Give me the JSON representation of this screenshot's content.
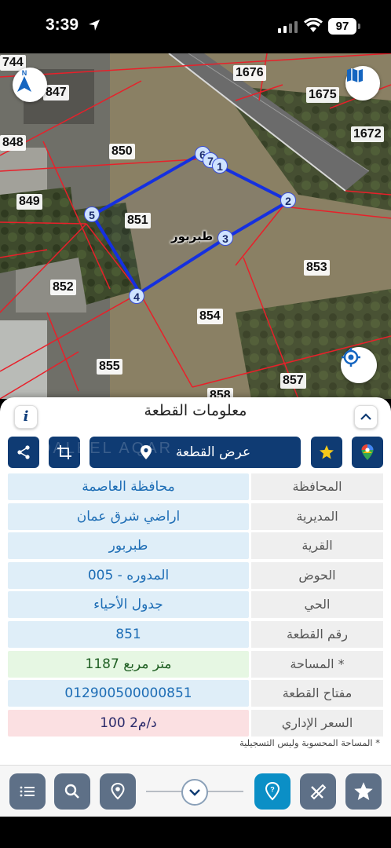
{
  "status_bar": {
    "time": "3:39",
    "battery": "97"
  },
  "map": {
    "parcels": [
      "744",
      "847",
      "1676",
      "1675",
      "1672",
      "848",
      "850",
      "849",
      "851",
      "852",
      "853",
      "854",
      "855",
      "857",
      "858"
    ],
    "vertices": [
      "6",
      "7",
      "1",
      "2",
      "3",
      "4",
      "5"
    ],
    "village_label": "طبربور"
  },
  "panel": {
    "title": "معلومات القطعة",
    "info_label": "i",
    "show_parcel_label": "عرض القطعة",
    "watermark": "DALEEL AQAR",
    "rows": [
      {
        "label": "المحافظة",
        "value": "محافظة العاصمة"
      },
      {
        "label": "المديرية",
        "value": "اراضي شرق عمان"
      },
      {
        "label": "القرية",
        "value": "طبربور"
      },
      {
        "label": "الحوض",
        "value": "المدوره - 005"
      },
      {
        "label": "الحي",
        "value": "جدول الأحياء"
      },
      {
        "label": "رقم القطعة",
        "value": "851"
      },
      {
        "label": "المساحة *",
        "value": "1187   متر مربع"
      },
      {
        "label": "مفتاح القطعة",
        "value": "012900500000851"
      },
      {
        "label": "السعر الإداري",
        "value": "100 د/م2"
      }
    ],
    "footnote": "* المساحة المحسوبة وليس التسجيلية"
  },
  "colors": {
    "navy": "#0f3b73",
    "active": "#0b8fc6",
    "toolbar_btn": "#5e7087",
    "parcel_outline": "#1530e0"
  },
  "icons": [
    "location-arrow-icon",
    "signal-icon",
    "wifi-icon",
    "north-arrow-icon",
    "map-layers-icon",
    "locate-icon",
    "info-icon",
    "chevron-up-icon",
    "share-icon",
    "crop-icon",
    "location-pin-icon",
    "star-icon",
    "google-maps-icon",
    "list-icon",
    "search-icon",
    "pin-icon",
    "chevron-down-icon",
    "help-pin-icon",
    "ruler-tools-icon",
    "favorite-icon"
  ]
}
